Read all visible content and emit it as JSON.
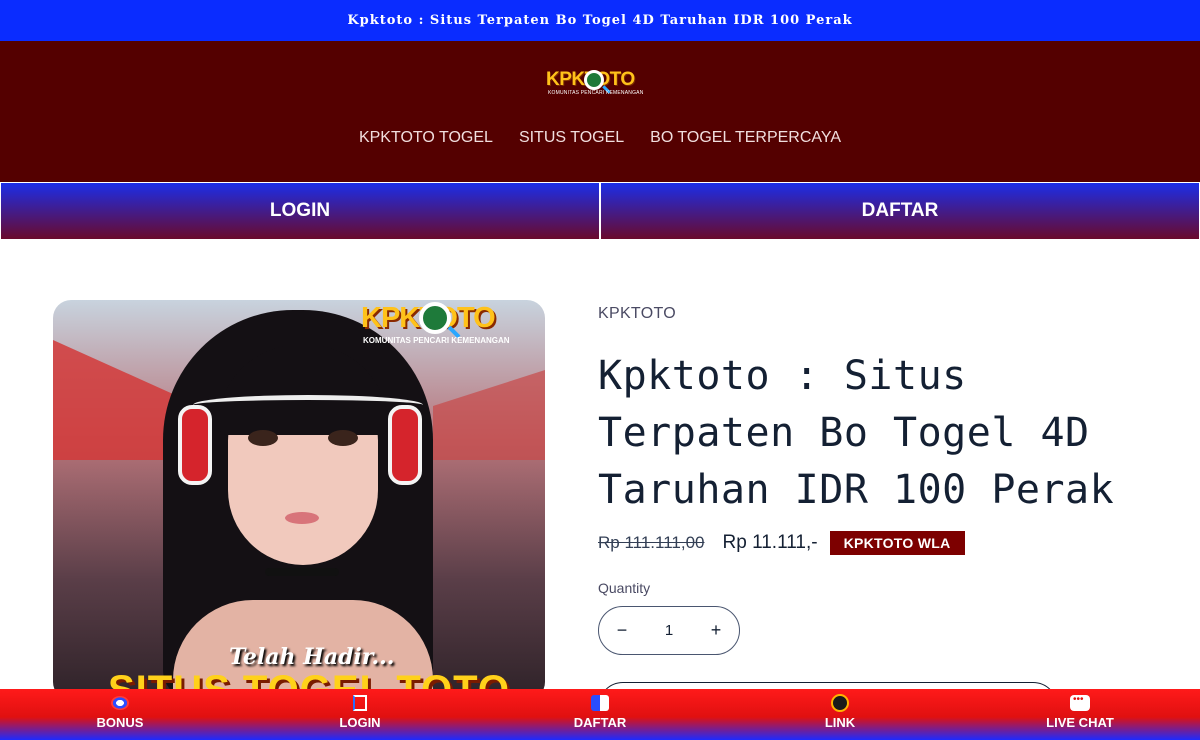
{
  "announcement": "Kpktoto : Situs Terpaten Bo Togel 4D Taruhan IDR 100 Perak",
  "header": {
    "logo_text": "KPKTOTO",
    "logo_tagline": "KOMUNITAS PENCARI KEMENANGAN",
    "nav": [
      "KPKTOTO TOGEL",
      "SITUS TOGEL",
      "BO TOGEL TERPERCAYA"
    ]
  },
  "auth": {
    "login_label": "LOGIN",
    "daftar_label": "DAFTAR"
  },
  "product": {
    "image_logo_text": "KPKTOTO",
    "image_logo_tagline": "KOMUNITAS PENCARI KEMENANGAN",
    "image_caption_small": "Telah Hadir...",
    "image_caption_big": "SITUS TOGEL TOTO",
    "vendor": "KPKTOTO",
    "title": "Kpktoto : Situs Terpaten Bo Togel 4D Taruhan IDR 100 Perak",
    "price_old": "Rp 111.111,00",
    "price_new": "Rp 11.111,-",
    "badge": "KPKTOTO WLA",
    "quantity_label": "Quantity",
    "quantity_value": "1",
    "qty_minus": "−",
    "qty_plus": "+"
  },
  "bottom_nav": [
    {
      "label": "BONUS",
      "icon": "bonus-icon"
    },
    {
      "label": "LOGIN",
      "icon": "login-icon"
    },
    {
      "label": "DAFTAR",
      "icon": "register-icon"
    },
    {
      "label": "LINK",
      "icon": "link-icon"
    },
    {
      "label": "LIVE CHAT",
      "icon": "chat-icon"
    }
  ],
  "colors": {
    "announcement_bg": "#0a2cff",
    "header_bg": "#540000",
    "badge_bg": "#7d0000",
    "logo_yellow": "#ffc21a"
  }
}
